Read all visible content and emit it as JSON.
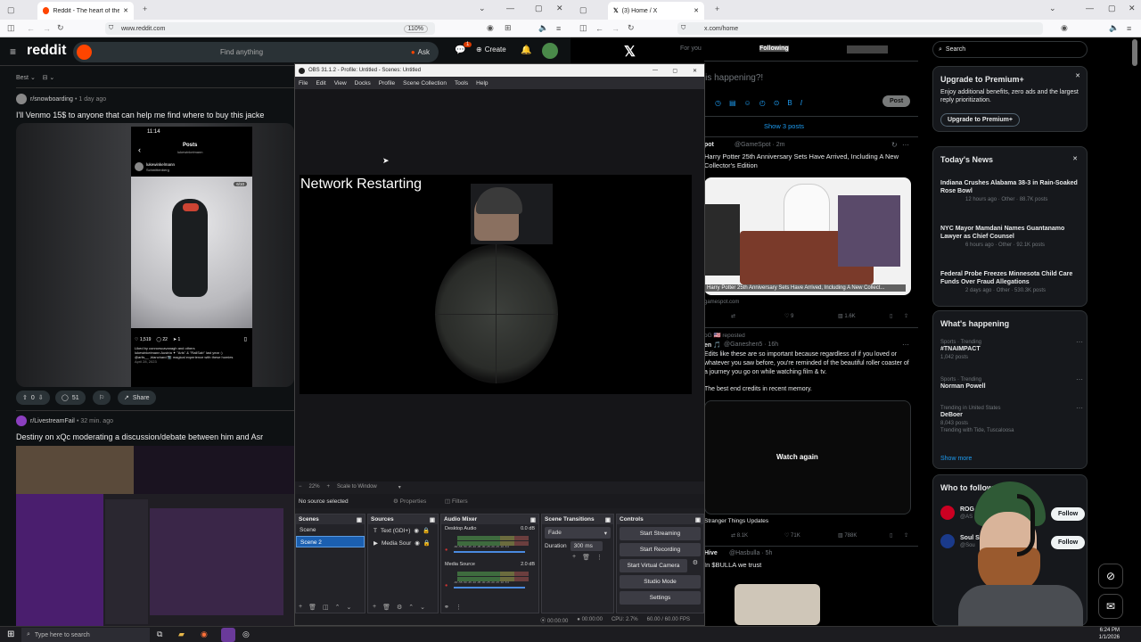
{
  "taskbar": {
    "search_placeholder": "Type here to search",
    "time": "6:24 PM",
    "date": "1/1/2026"
  },
  "reddit_window": {
    "tab_title": "Reddit - The heart of the interne",
    "url": "www.reddit.com",
    "zoom": "110%",
    "logo": "reddit",
    "search_placeholder": "Find anything",
    "ask_label": "Ask",
    "create_label": "Create",
    "notif_badge": "1",
    "sort_label": "Best",
    "post1": {
      "subreddit": "r/snowboarding",
      "age": "• 1 day ago",
      "title": "I'll Venmo 15$ to anyone that can help me find where to buy this jacke",
      "votes": "0",
      "comments": "51",
      "share": "Share",
      "phone": {
        "time": "11:14",
        "header": "Posts",
        "subheader": "lukewinkelmann",
        "user": "lukewinkelmann",
        "location": "Schmittenberg",
        "counter": "6/10",
        "likes": "1,519",
        "comments": "22",
        "shares": "1",
        "caption": "Liked by connorscavanagh and others",
        "caption2": "lukewinkelmann Austria ✦ \"Arls\" & \"RailSab\" last year :)",
        "caption3": "@arlis__ ,blanchard 📷 magical experience with these homies",
        "date": "April 28, 2023"
      }
    },
    "post2": {
      "subreddit": "r/LivestreamFail",
      "age": "• 32 min. ago",
      "title": "Destiny on xQc moderating a discussion/debate between him and Asr"
    }
  },
  "obs": {
    "title": "OBS 31.1.2 - Profile: Untitled - Scenes: Untitled",
    "menu": [
      "File",
      "Edit",
      "View",
      "Docks",
      "Profile",
      "Scene Collection",
      "Tools",
      "Help"
    ],
    "overlay_text": "Network Restarting",
    "zoom": "22%",
    "scale_mode": "Scale to Window",
    "no_source": "No source selected",
    "properties_label": "Properties",
    "filters_label": "Filters",
    "scenes": {
      "title": "Scenes",
      "items": [
        "Scene",
        "Scene 2"
      ]
    },
    "sources": {
      "title": "Sources",
      "items": [
        "Text (GDI+)",
        "Media Sour"
      ]
    },
    "mixer": {
      "title": "Audio Mixer",
      "channels": [
        {
          "name": "Desktop Audio",
          "db": "0.0 dB"
        },
        {
          "name": "Media Source",
          "db": "2.0 dB"
        }
      ],
      "scale": "-60 -55 -50 -45 -40 -35 -30 -25 -20 -15 -10 -5 0"
    },
    "transitions": {
      "title": "Scene Transitions",
      "type": "Fade",
      "duration_label": "Duration",
      "duration": "300 ms"
    },
    "controls": {
      "title": "Controls",
      "buttons": [
        "Start Streaming",
        "Start Recording",
        "Start Virtual Camera",
        "Studio Mode",
        "Settings"
      ]
    },
    "status": {
      "stream_time": "00:00:00",
      "rec_time": "00:00:00",
      "cpu": "CPU: 2.7%",
      "fps": "60.00 / 60.00 FPS"
    }
  },
  "x_window": {
    "tab_title": "(3) Home / X",
    "url": "x.com/home",
    "tabs": [
      "For you",
      "Following"
    ],
    "compose_placeholder": "at is happening?!",
    "post_button": "Post",
    "show_posts": "Show 3 posts",
    "tweet1": {
      "handle": "@GameSpot · 2m",
      "name": "GameSpot",
      "text": "Harry Potter 25th Anniversary Sets Have Arrived, Including A New Collector's Edition",
      "caption": "Harry Potter 25th Anniversary Sets Have Arrived, Including A New Collect...",
      "domain": "gamespot.com",
      "likes": "9",
      "views": "1.6K"
    },
    "repost_label": "reposted",
    "tweet2": {
      "handle": "@Ganeshen5 · 16h",
      "text": "Edits like these are so important because regardless of if you loved or whatever you saw before, you're reminded of the beautiful roller coaster of a journey you go on while watching film & tv.",
      "text2": "The best end credits in recent memory.",
      "watch_again": "Watch again",
      "caption": "Stranger Things Updates",
      "reposts": "8.1K",
      "likes": "71K",
      "views": "788K"
    },
    "tweet3": {
      "handle": "@Hasbulla · 5h",
      "text": "In $BULLA we trust",
      "name": "Hive"
    },
    "search_placeholder": "Search",
    "premium": {
      "title": "Upgrade to Premium+",
      "text": "Enjoy additional benefits, zero ads and the largest reply prioritization.",
      "button": "Upgrade to Premium+"
    },
    "news": {
      "title": "Today's News",
      "items": [
        {
          "headline": "Indiana Crushes Alabama 38-3 in Rain-Soaked Rose Bowl",
          "meta": "12 hours ago · Other · 88.7K posts"
        },
        {
          "headline": "NYC Mayor Mamdani Names Guantanamo Lawyer as Chief Counsel",
          "meta": "6 hours ago · Other · 92.1K posts"
        },
        {
          "headline": "Federal Probe Freezes Minnesota Child Care Funds Over Fraud Allegations",
          "meta": "2 days ago · Other · 530.3K posts"
        }
      ]
    },
    "happening": {
      "title": "What's happening",
      "items": [
        {
          "context": "Sports · Trending",
          "topic": "#TNAIMPACT",
          "posts": "1,042 posts"
        },
        {
          "context": "Sports · Trending",
          "topic": "Norman Powell",
          "posts": ""
        },
        {
          "context": "Trending in United States",
          "topic": "DeBoer",
          "posts": "8,043 posts",
          "extra": "Trending with Tide, Tuscaloosa"
        }
      ],
      "show_more": "Show more"
    },
    "who": {
      "title": "Who to follow",
      "items": [
        {
          "name": "ROG",
          "handle": "@AS"
        },
        {
          "name": "Soul S",
          "handle": "@Sou"
        }
      ],
      "follow_label": "Follow"
    }
  }
}
